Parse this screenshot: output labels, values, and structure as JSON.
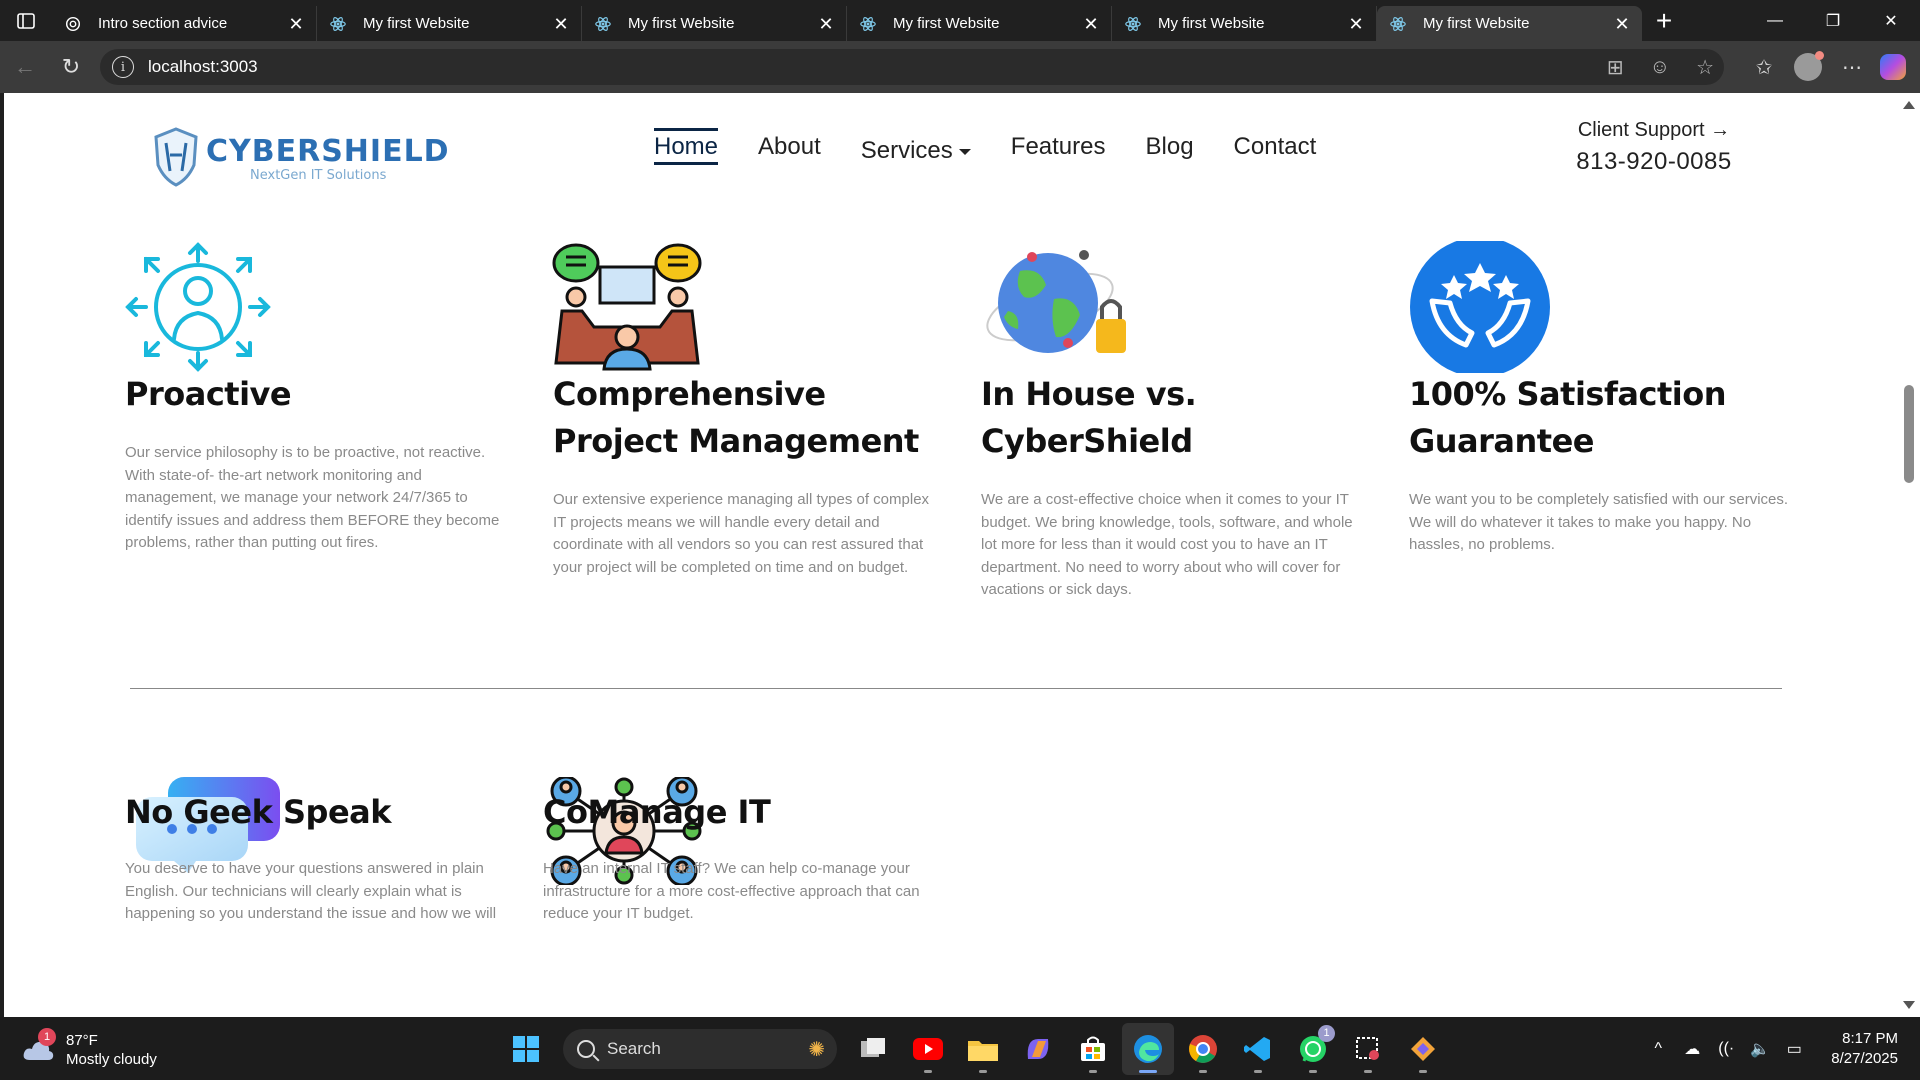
{
  "browser": {
    "tabs": [
      {
        "title": "Intro section advice",
        "icon": "openai-icon",
        "active": false
      },
      {
        "title": "My first Website",
        "icon": "react-icon",
        "active": false
      },
      {
        "title": "My first Website",
        "icon": "react-icon",
        "active": false
      },
      {
        "title": "My first Website",
        "icon": "react-icon",
        "active": false
      },
      {
        "title": "My first Website",
        "icon": "react-icon",
        "active": false
      },
      {
        "title": "My first Website",
        "icon": "react-icon",
        "active": true
      }
    ],
    "url": "localhost:3003"
  },
  "site": {
    "logo": {
      "name": "CYBERSHIELD",
      "tagline": "NextGen IT Solutions"
    },
    "nav": {
      "home": "Home",
      "about": "About",
      "services": "Services",
      "features": "Features",
      "blog": "Blog",
      "contact": "Contact"
    },
    "support": {
      "label": "Client Support",
      "phone": "813-920-0085"
    },
    "features": [
      {
        "title": "Proactive",
        "body": "Our service philosophy is to be proactive, not reactive. With state-of- the-art network monitoring and management, we manage your network 24/7/365 to identify issues and address them BEFORE they become problems, rather than putting out fires.",
        "icon": "manager-arrows-icon"
      },
      {
        "title": "Comprehensive Project Management",
        "body": "Our extensive experience managing all types of complex IT projects means we will handle every detail and coordinate with all vendors so you can rest assured that your project will be completed on time and on budget.",
        "icon": "meeting-table-icon"
      },
      {
        "title": "In House vs. CyberShield",
        "body": "We are a cost-effective choice when it comes to your IT budget. We bring knowledge, tools, software, and whole lot more for less than it would cost you to have an IT department. No need to worry about who will cover for vacations or sick days.",
        "icon": "globe-lock-icon"
      },
      {
        "title": "100% Satisfaction Guarantee",
        "body": "We want you to be completely satisfied with our services. We will do whatever it takes to make you happy. No hassles, no problems.",
        "icon": "hands-stars-icon"
      },
      {
        "title": "No Geek Speak",
        "body": "You deserve to have your questions answered in plain English. Our technicians will clearly explain what is happening so you understand the issue and how we will",
        "icon": "chat-bubbles-icon"
      },
      {
        "title": "CoManage IT",
        "body": "Have an internal IT staff? We can help co-manage your infrastructure for a more cost-effective approach that can reduce your IT budget.",
        "icon": "network-people-icon"
      }
    ]
  },
  "taskbar": {
    "weather": {
      "temp": "87°F",
      "condition": "Mostly cloudy",
      "badge": "1"
    },
    "search_placeholder": "Search",
    "whatsapp_badge": "1",
    "time": "8:17 PM",
    "date": "8/27/2025"
  }
}
